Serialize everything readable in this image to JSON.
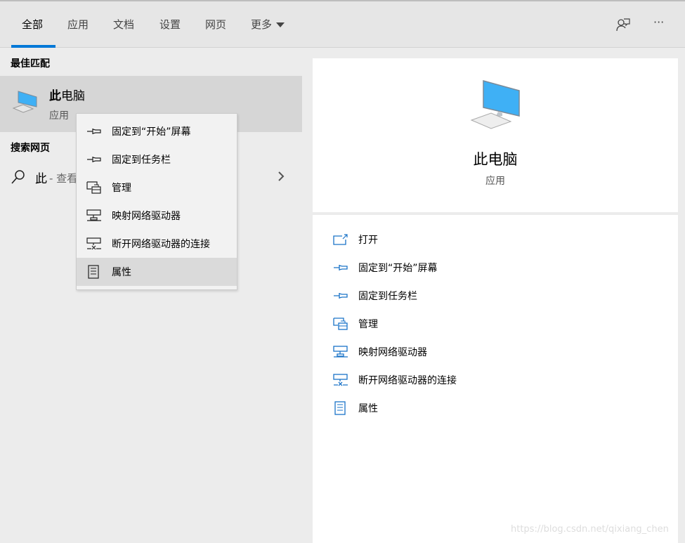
{
  "tabs": [
    {
      "label": "全部",
      "active": true
    },
    {
      "label": "应用"
    },
    {
      "label": "文档"
    },
    {
      "label": "设置"
    },
    {
      "label": "网页"
    },
    {
      "label": "更多"
    }
  ],
  "toolbar": {
    "feedback_icon": "feedback-person-icon",
    "more_icon": "ellipsis-icon",
    "more_label": "···"
  },
  "left": {
    "best_match_header": "最佳匹配",
    "best_match": {
      "title_bold": "此",
      "title_rest": "电脑",
      "subtitle": "应用",
      "icon": "computer-icon"
    },
    "web_header": "搜索网页",
    "web_query": "此",
    "web_suffix": "- 查看"
  },
  "context_menu": [
    {
      "label": "固定到“开始”屏幕",
      "icon": "pin-icon"
    },
    {
      "label": "固定到任务栏",
      "icon": "pin-icon"
    },
    {
      "label": "管理",
      "icon": "manage-icon"
    },
    {
      "label": "映射网络驱动器",
      "icon": "map-drive-icon"
    },
    {
      "label": "断开网络驱动器的连接",
      "icon": "disconnect-drive-icon"
    },
    {
      "label": "属性",
      "icon": "properties-icon",
      "hovered": true
    }
  ],
  "preview": {
    "title": "此电脑",
    "subtitle": "应用"
  },
  "actions": [
    {
      "label": "打开",
      "icon": "open-icon"
    },
    {
      "label": "固定到“开始”屏幕",
      "icon": "pin-icon"
    },
    {
      "label": "固定到任务栏",
      "icon": "pin-icon"
    },
    {
      "label": "管理",
      "icon": "manage-icon"
    },
    {
      "label": "映射网络驱动器",
      "icon": "map-drive-icon"
    },
    {
      "label": "断开网络驱动器的连接",
      "icon": "disconnect-drive-icon"
    },
    {
      "label": "属性",
      "icon": "properties-icon"
    }
  ],
  "colors": {
    "accent": "#0078d7",
    "icon_blue": "#1a73c8"
  },
  "watermark": "https://blog.csdn.net/qixiang_chen"
}
